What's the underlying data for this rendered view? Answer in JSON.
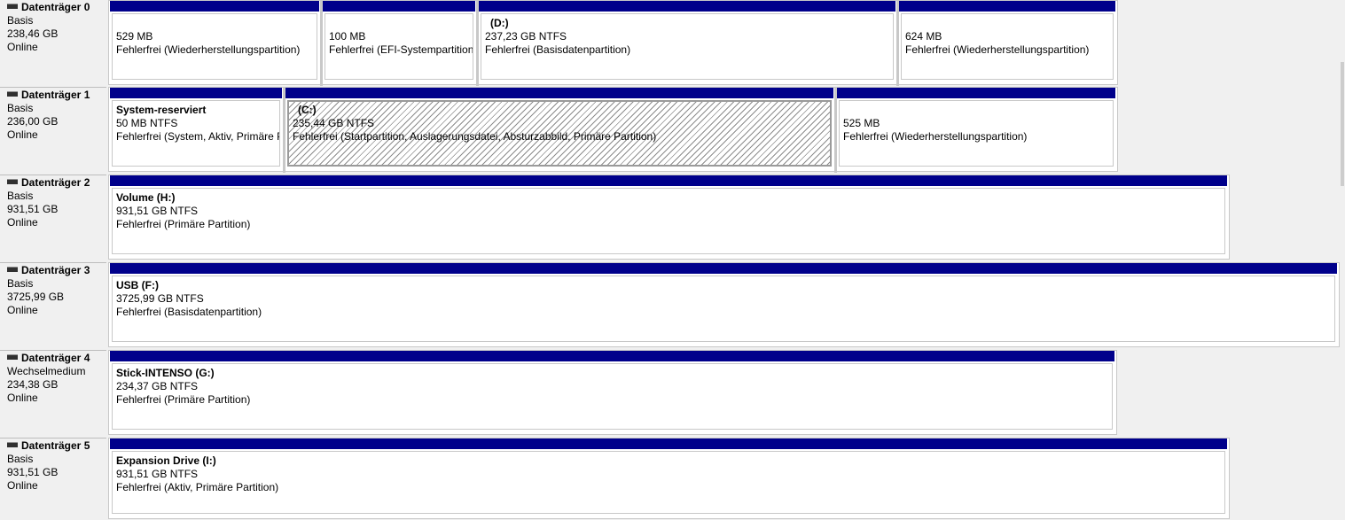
{
  "disks": [
    {
      "title": "Datenträger 0",
      "type": "Basis",
      "size": "238,46 GB",
      "status": "Online",
      "partitions": [
        {
          "name": "",
          "size": "529 MB",
          "status": "Fehlerfrei (Wiederherstellungspartition)"
        },
        {
          "name": "",
          "size": "100 MB",
          "status": "Fehlerfrei (EFI-Systempartition)"
        },
        {
          "name": "(D:)",
          "size": "237,23 GB NTFS",
          "status": "Fehlerfrei (Basisdatenpartition)"
        },
        {
          "name": "",
          "size": "624 MB",
          "status": "Fehlerfrei (Wiederherstellungspartition)"
        }
      ]
    },
    {
      "title": "Datenträger 1",
      "type": "Basis",
      "size": "236,00 GB",
      "status": "Online",
      "partitions": [
        {
          "name": "System-reserviert",
          "size": "50 MB NTFS",
          "status": "Fehlerfrei (System, Aktiv, Primäre Partition)"
        },
        {
          "name": "(C:)",
          "size": "235,44 GB NTFS",
          "status": "Fehlerfrei (Startpartition, Auslagerungsdatei, Absturzabbild, Primäre Partition)"
        },
        {
          "name": "",
          "size": "525 MB",
          "status": "Fehlerfrei (Wiederherstellungspartition)"
        }
      ]
    },
    {
      "title": "Datenträger 2",
      "type": "Basis",
      "size": "931,51 GB",
      "status": "Online",
      "partitions": [
        {
          "name": "Volume  (H:)",
          "size": "931,51 GB NTFS",
          "status": "Fehlerfrei (Primäre Partition)"
        }
      ]
    },
    {
      "title": "Datenträger 3",
      "type": "Basis",
      "size": "3725,99 GB",
      "status": "Online",
      "partitions": [
        {
          "name": "USB  (F:)",
          "size": "3725,99 GB NTFS",
          "status": "Fehlerfrei (Basisdatenpartition)"
        }
      ]
    },
    {
      "title": "Datenträger 4",
      "type": "Wechselmedium",
      "size": "234,38 GB",
      "status": "Online",
      "partitions": [
        {
          "name": "Stick-INTENSO  (G:)",
          "size": "234,37 GB NTFS",
          "status": "Fehlerfrei (Primäre Partition)"
        }
      ]
    },
    {
      "title": "Datenträger 5",
      "type": "Basis",
      "size": "931,51 GB",
      "status": "Online",
      "partitions": [
        {
          "name": "Expansion Drive  (I:)",
          "size": "931,51 GB NTFS",
          "status": "Fehlerfrei (Aktiv, Primäre Partition)"
        }
      ]
    }
  ],
  "colors": {
    "partition_bar": "#00008b",
    "background": "#f0f0f0",
    "partition_body": "#ffffff",
    "selected_hatch": "#8c8c8c"
  },
  "icons": {
    "disk": "hard-disk-icon"
  }
}
